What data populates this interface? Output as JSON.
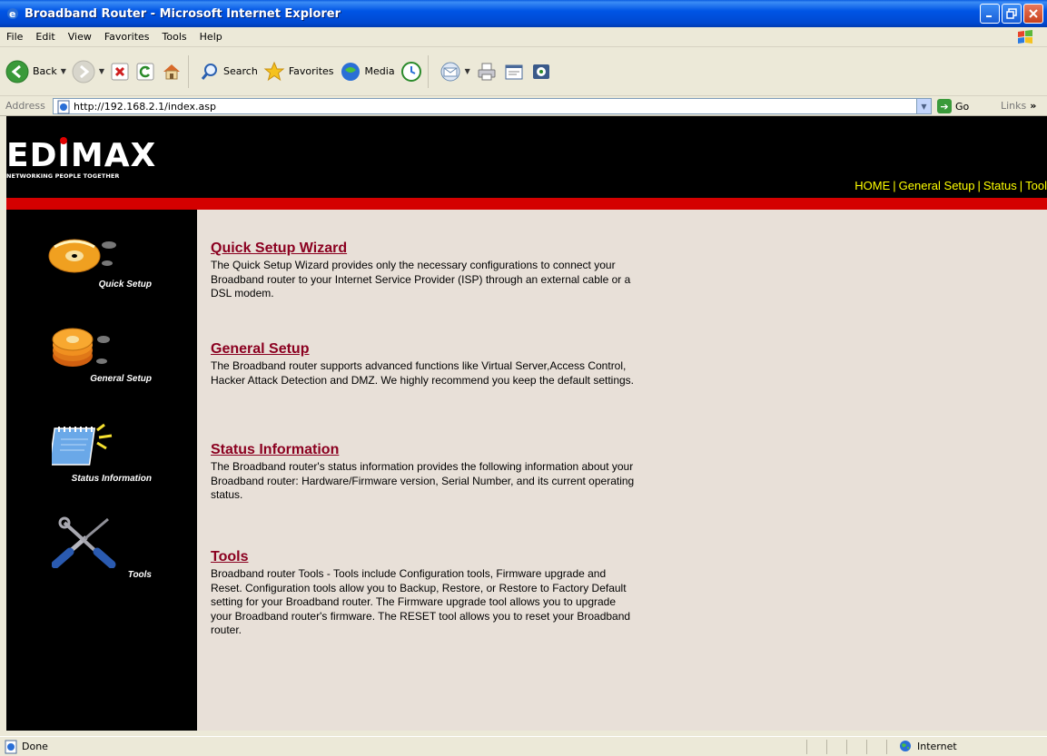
{
  "window": {
    "title": "Broadband Router - Microsoft Internet Explorer"
  },
  "menu": [
    "File",
    "Edit",
    "View",
    "Favorites",
    "Tools",
    "Help"
  ],
  "toolbar": {
    "back_label": "Back",
    "search_label": "Search",
    "favorites_label": "Favorites",
    "media_label": "Media"
  },
  "address": {
    "label": "Address",
    "url": "http://192.168.2.1/index.asp",
    "go_label": "Go",
    "links_label": "Links"
  },
  "brand": {
    "logo": "EDIMAX",
    "tagline": "NETWORKING PEOPLE TOGETHER"
  },
  "topnav": [
    "HOME",
    "General Setup",
    "Status",
    "Tool"
  ],
  "sidebar": [
    {
      "label": "Quick Setup",
      "icon": "quick-setup-disc-icon"
    },
    {
      "label": "General Setup",
      "icon": "general-setup-discs-icon"
    },
    {
      "label": "Status Information",
      "icon": "status-notepad-icon"
    },
    {
      "label": "Tools",
      "icon": "tools-screwdriver-icon"
    }
  ],
  "sections": [
    {
      "title": "Quick Setup Wizard",
      "description": "The Quick Setup Wizard provides only the necessary configurations to connect your Broadband router to your Internet Service Provider (ISP) through an external cable or a DSL modem."
    },
    {
      "title": "General Setup",
      "description": "The Broadband router supports advanced functions like Virtual Server,Access Control, Hacker Attack Detection and DMZ. We highly recommend you keep the default settings."
    },
    {
      "title": "Status Information",
      "description": "The Broadband router's status information provides the following information about your Broadband router: Hardware/Firmware version, Serial Number, and its current operating status."
    },
    {
      "title": "Tools",
      "description": "Broadband router Tools - Tools include Configuration tools, Firmware upgrade and Reset. Configuration tools allow you to Backup, Restore, or Restore to Factory Default setting for your Broadband router. The Firmware upgrade tool allows you to upgrade your Broadband router's firmware. The RESET tool allows you to reset your Broadband router."
    }
  ],
  "status": {
    "text": "Done",
    "zone": "Internet"
  },
  "colors": {
    "titlebar": "#0055e5",
    "header_bg": "#000000",
    "red_bar": "#d40000",
    "nav_text": "#ffff00",
    "heading": "#8b0020",
    "page_bg": "#e8e0d8"
  }
}
